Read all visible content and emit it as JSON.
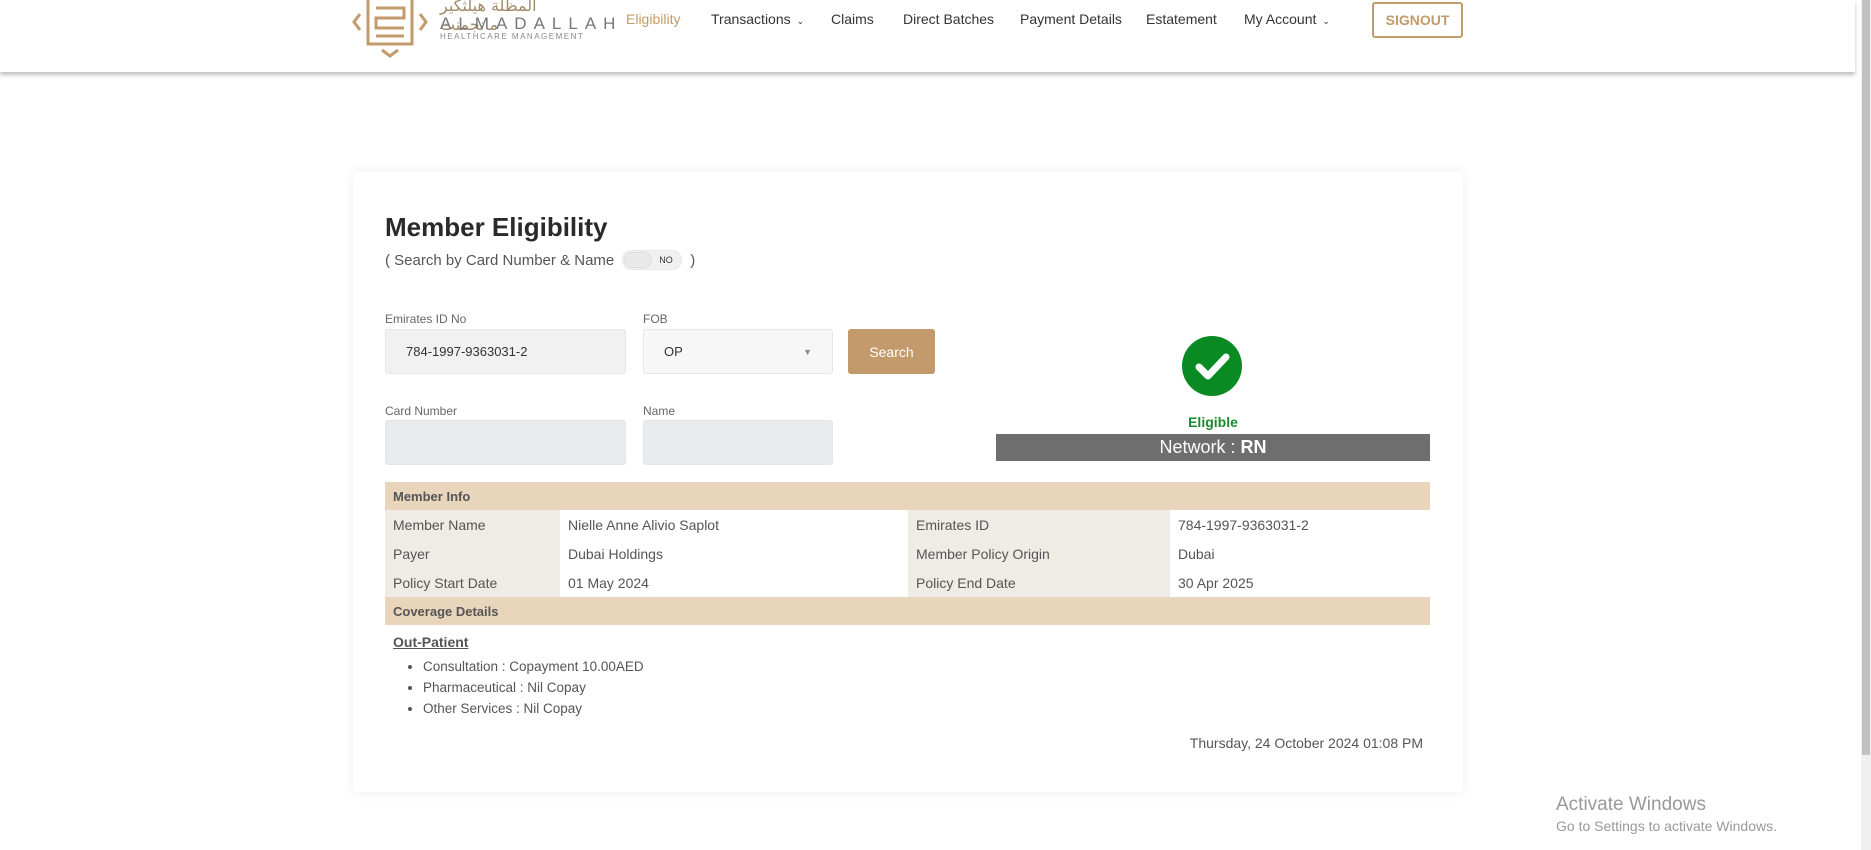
{
  "brand": {
    "arabic": "المظلة هيلثكير مانجمنت",
    "name": "ALMADALLAH",
    "tagline": "HEALTHCARE MANAGEMENT"
  },
  "nav": [
    "Eligibility",
    "Transactions",
    "Claims",
    "Direct Batches",
    "Payment Details",
    "Estatement",
    "My Account"
  ],
  "signout": "SIGNOUT",
  "page": {
    "title": "Member Eligibility",
    "search_toggle_open": "( Search by Card Number & Name",
    "search_toggle_close": ")",
    "toggle_value": "NO"
  },
  "form": {
    "emirates_label": "Emirates ID No",
    "emirates_value": "784-1997-9363031-2",
    "fob_label": "FOB",
    "fob_value": "OP",
    "search": "Search",
    "card_label": "Card Number",
    "card_value": "",
    "name_label": "Name",
    "name_value": ""
  },
  "status": {
    "label": "Eligible",
    "network_prefix": "Network : ",
    "network": "RN",
    "color": "#0a8a23"
  },
  "member_info": {
    "header": "Member Info",
    "rows": [
      [
        "Member Name",
        "Nielle Anne Alivio Saplot",
        "Emirates ID",
        "784-1997-9363031-2"
      ],
      [
        "Payer",
        "Dubai Holdings",
        "Member Policy Origin",
        "Dubai"
      ],
      [
        "Policy Start Date",
        "01 May 2024",
        "Policy End Date",
        "30 Apr 2025"
      ]
    ]
  },
  "coverage": {
    "header": "Coverage Details",
    "section": "Out-Patient",
    "items": [
      "Consultation : Copayment 10.00AED",
      "Pharmaceutical : Nil Copay",
      "Other Services : Nil Copay"
    ]
  },
  "timestamp": "Thursday, 24 October 2024 01:08 PM",
  "watermark": {
    "title": "Activate Windows",
    "sub": "Go to Settings to activate Windows."
  }
}
